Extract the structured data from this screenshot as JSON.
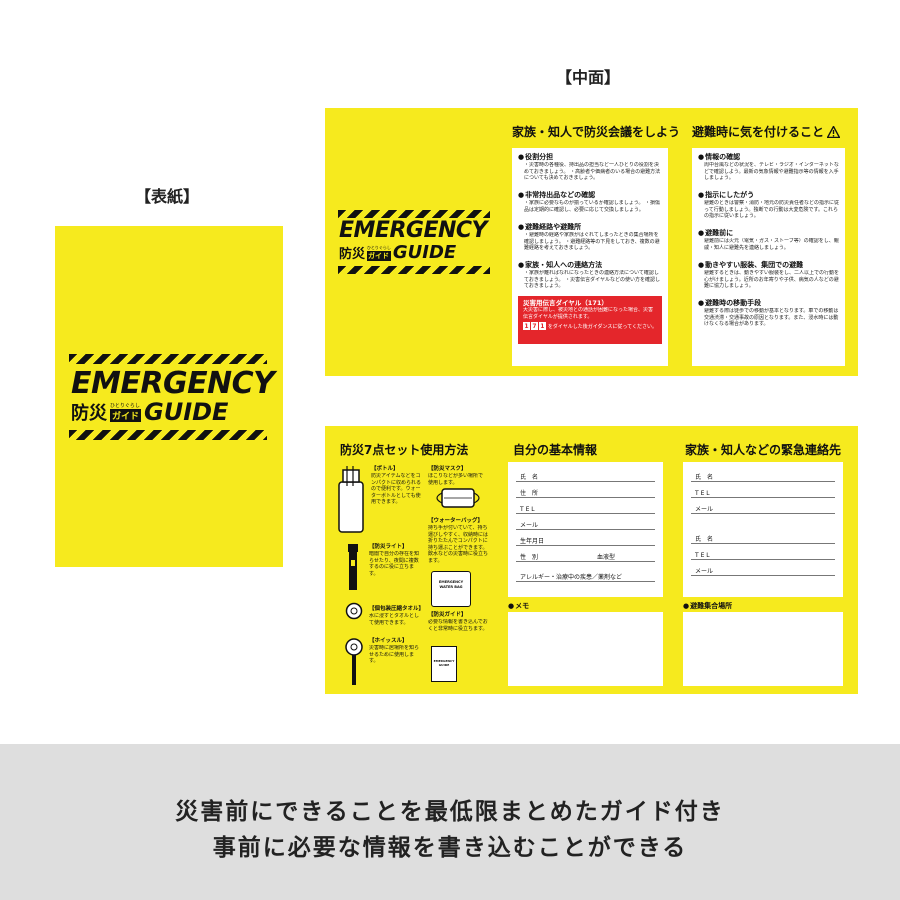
{
  "labels": {
    "cover": "【表紙】",
    "inside": "【中面】"
  },
  "logo": {
    "title": "EMERGENCY",
    "bosai": "防災",
    "furigana": "ひとりぐらし",
    "guide_tag": "ガイド",
    "guide_word": "GUIDE"
  },
  "inside_top": {
    "meeting": {
      "title": "家族・知人で防災会議をしよう",
      "items": [
        {
          "head": "役割分担",
          "text": "・災害時の各種役、持出品の担当など一人ひとりの役割を決めておきましょう。 ・高齢者や価病者のいる場合の避難方法についても決めておきましょう。"
        },
        {
          "head": "非常持出品などの確認",
          "text": "・家族に必要なものが揃っているか確認しましょう。 ・損傷品は定期的に確認し、必要に応じて交換しましょう。"
        },
        {
          "head": "避難経路や避難所",
          "text": "・避難時の経路や家族がはぐれてしまったときの集合場所を確認しましょう。 ・避難経路等の下見をしておき、複数の避難経路を考えておきましょう。"
        },
        {
          "head": "家族・知人への連絡方法",
          "text": "・家族が離ればなれになったときの連絡方法について確認しておきましょう。 ・災害伝言ダイヤルなどの使い方を確認しておきましょう。"
        }
      ],
      "dial": {
        "title": "災害用伝言ダイヤル（171）",
        "text": "大災害に際し、被災地との通話が困難になった場合、災害伝言ダイヤルが提供されます。",
        "digits": [
          "1",
          "7",
          "1"
        ],
        "after": "をダイヤルした後ガイダンスに従ってください。"
      }
    },
    "evac": {
      "title": "避難時に気を付けること",
      "warn_icon": "warning-icon",
      "items": [
        {
          "head": "情報の確認",
          "text": "周中台風などの状況を、テレビ・ラジオ・インターネットなどで確認しよう。最新の気象情報や避難指示等の情報を入手しましょう。"
        },
        {
          "head": "指示にしたがう",
          "text": "避難のときは警察・消防・地元の防災責任者などの指示に従って行動しましょう。独断での行動は大変危険です。これらの指示に従いましょう。"
        },
        {
          "head": "避難前に",
          "text": "避難前には火元（電気・ガス・ストーブ等）の確認をし、親戚・知人に避難先を連絡しましょう。"
        },
        {
          "head": "動きやすい服装、集団での避難",
          "text": "避難するときは、動きやすい服装をし、二人以上での行動を心がけましょう。近所のお年寄りや子供、病気の人などの避難に協力しましょう。"
        },
        {
          "head": "避難時の移動手段",
          "text": "避難する際は徒歩での移動が基本となります。車での移動は交通渋滞・交通事故の原因となります。また、浸水時には動けなくなる場合があります。"
        }
      ]
    }
  },
  "inside_bottom": {
    "kit": {
      "title": "防災7点セット使用方法",
      "tools": [
        {
          "name": "【ボトル】",
          "text": "防災アイテムなどをコンパクトに収められるので便利です。ウォーターボトルとしても使用できます。"
        },
        {
          "name": "【防災マスク】",
          "text": "ほこりなどが多い場所で使用します。"
        },
        {
          "name": "【防災ライト】",
          "text": "暗闇で自分の存在を知らせたり、夜間に複数するのに役に立ちます。"
        },
        {
          "name": "【ウォーターバッグ】",
          "text": "持ち手が付いていて、持ち運びしやすく、収納時には折りたたんでコンパクトに持ち運ぶことができます。飲水などの災害時に役立ちます。"
        },
        {
          "name": "【個包装圧縮タオル】",
          "text": "水に浸すとタオルとして使用できます。"
        },
        {
          "name": "【防災ガイド】",
          "text": "必要な情報を書き込んでおくと非常時に役立ちます。"
        },
        {
          "name": "【ホイッスル】",
          "text": "災害時に居場所を知らせるために使用します。"
        }
      ],
      "bag_label": "EMERGENCY WATER BAG",
      "guide_label": "EMERGENCY GUIDE"
    },
    "basic": {
      "title": "自分の基本情報",
      "fields": [
        "氏　名",
        "住　所",
        "T E L",
        "メール",
        "生年月日",
        "性　別",
        "血液型",
        "アレルギー・治療中の疾患／薬剤など"
      ],
      "memo": "メモ"
    },
    "contacts": {
      "title": "家族・知人などの緊急連絡先",
      "fields": [
        "氏　名",
        "T E L",
        "メール",
        "氏　名",
        "T E L",
        "メール"
      ],
      "gather": "避難集合場所"
    }
  },
  "footer": {
    "line1": "災害前にできることを最低限まとめたガイド付き",
    "line2": "事前に必要な情報を書き込むことができる"
  },
  "colors": {
    "yellow": "#f6ea1e",
    "black": "#111111",
    "red": "#e4262b",
    "footer_bg": "#dedede"
  }
}
